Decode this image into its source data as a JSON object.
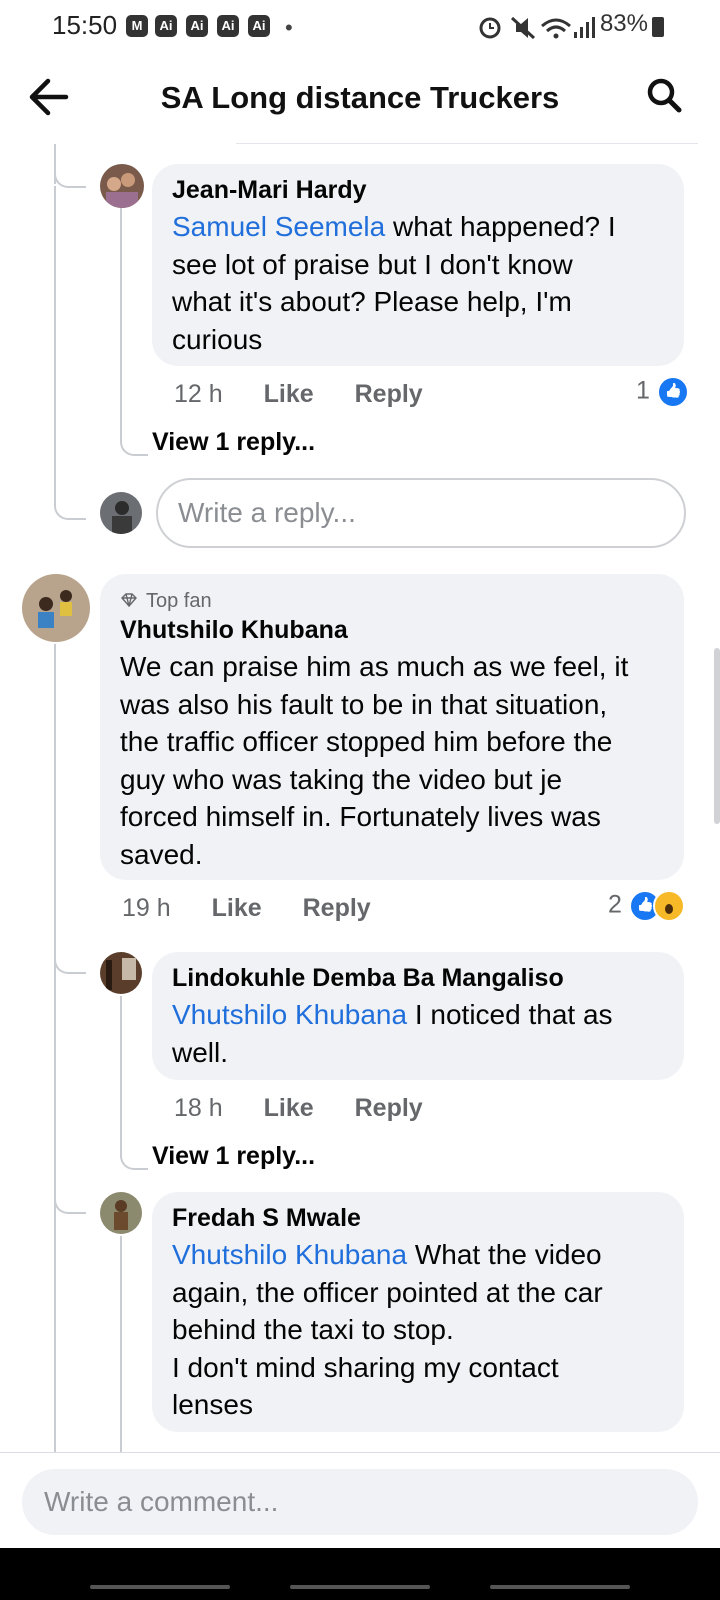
{
  "status_bar": {
    "time": "15:50",
    "notif_icons": [
      "M",
      "Ai",
      "Ai",
      "Ai",
      "Ai"
    ],
    "right": "83%"
  },
  "header": {
    "title": "SA Long distance Truckers",
    "back_icon": "arrow-left",
    "search_icon": "magnifier"
  },
  "comments": [
    {
      "author": "Jean-Mari Hardy",
      "mention": "Samuel Seemela",
      "line1": " what happened? I",
      "line2": "see lot of praise but I don't know",
      "line3": "what it's about? Please help, I'm",
      "line4": "curious",
      "time": "12 h",
      "like": "Like",
      "reply": "Reply",
      "reaction_count": "1",
      "view_replies": "View 1 reply..."
    },
    {
      "badge": "Top fan",
      "author": "Vhutshilo Khubana",
      "line1": "We can praise him as much as we feel, it",
      "line2": "was also his fault to be in that situation,",
      "line3": "the traffic officer stopped him before the",
      "line4": "guy who was taking the video but je",
      "line5": "forced himself in. Fortunately lives was",
      "line6": "saved.",
      "time": "19 h",
      "like": "Like",
      "reply": "Reply",
      "reaction_count": "2"
    },
    {
      "author": "Lindokuhle Demba Ba Mangaliso",
      "mention": "Vhutshilo Khubana",
      "line1": " I noticed that as",
      "line2": "well.",
      "time": "18 h",
      "like": "Like",
      "reply": "Reply",
      "view_replies": "View 1 reply..."
    },
    {
      "author": "Fredah S Mwale",
      "mention": "Vhutshilo Khubana",
      "line1": " What the video",
      "line2": "again, the officer pointed at the car",
      "line3": "behind the taxi to stop.",
      "line4": "I don't mind sharing my contact",
      "line5": "lenses"
    }
  ],
  "reply_input": {
    "placeholder": "Write a reply..."
  },
  "composer": {
    "placeholder": "Write a comment..."
  }
}
